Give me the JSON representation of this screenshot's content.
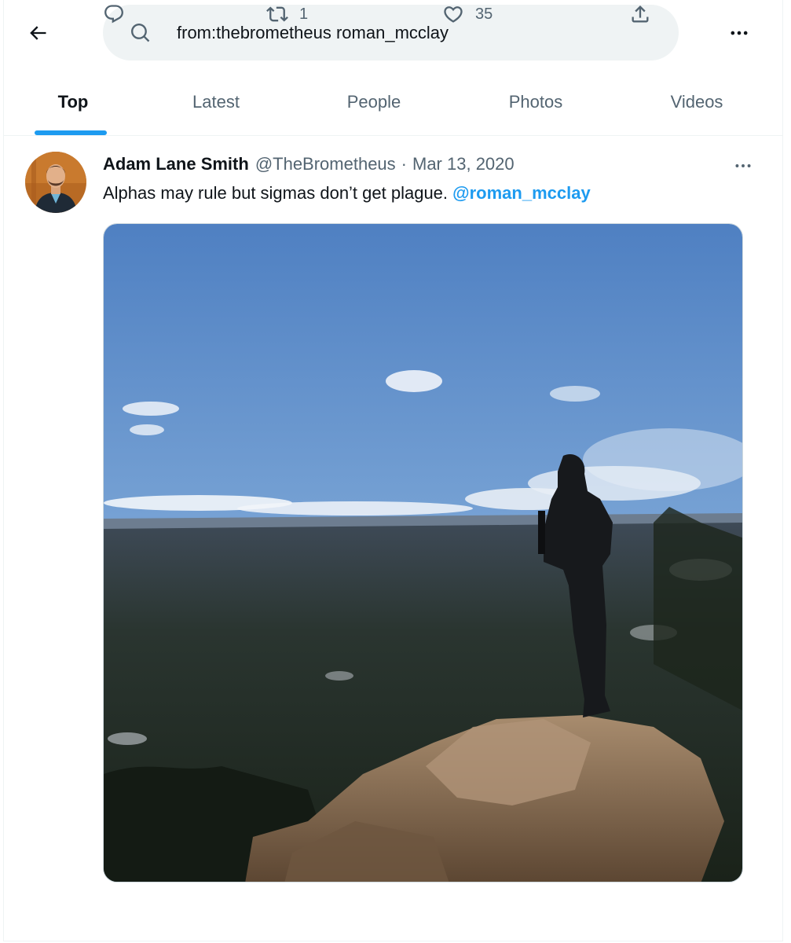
{
  "search": {
    "query": "from:thebrometheus roman_mcclay"
  },
  "tabs": [
    {
      "label": "Top"
    },
    {
      "label": "Latest"
    },
    {
      "label": "People"
    },
    {
      "label": "Photos"
    },
    {
      "label": "Videos"
    }
  ],
  "tweet": {
    "display_name": "Adam Lane Smith",
    "handle": "@TheBrometheus",
    "separator": "·",
    "date": "Mar 13, 2020",
    "text": "Alphas may rule but sigmas don’t get plague.",
    "mention": "@roman_mcclay",
    "retweet_count": "1",
    "like_count": "35"
  },
  "colors": {
    "accent": "#1d9bf0",
    "text_primary": "#0f1419",
    "text_secondary": "#536471",
    "search_bg": "#eff3f4"
  },
  "icons": {
    "back": "arrow-left-icon",
    "search": "search-icon",
    "more": "more-horizontal-icon",
    "reply": "reply-icon",
    "retweet": "retweet-icon",
    "like": "heart-icon",
    "share": "share-icon"
  }
}
